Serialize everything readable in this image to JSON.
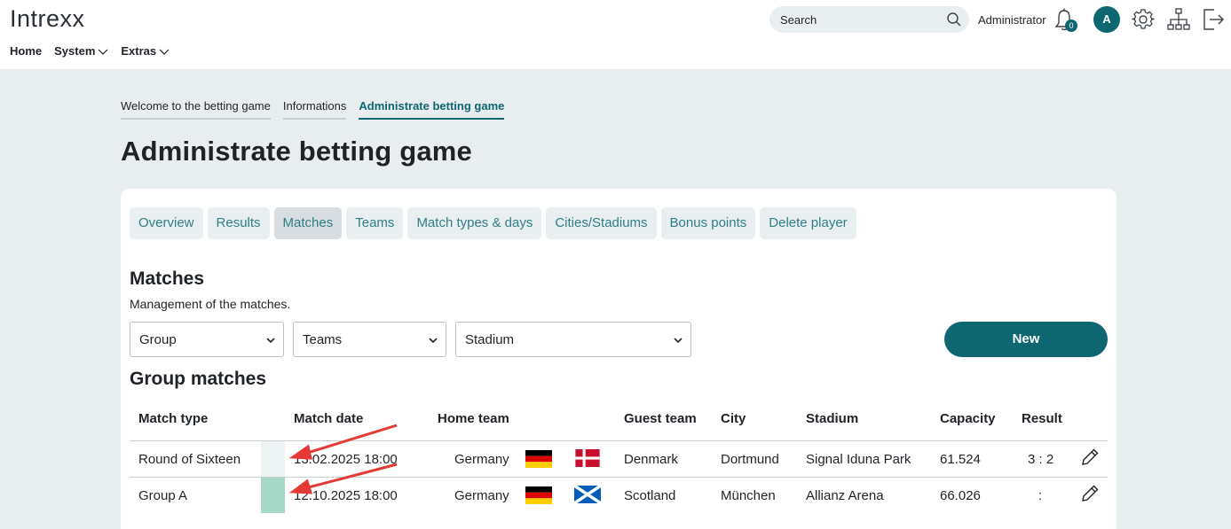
{
  "app": {
    "logo": "Intrexx"
  },
  "nav": [
    {
      "label": "Home",
      "has_menu": false
    },
    {
      "label": "System",
      "has_menu": true
    },
    {
      "label": "Extras",
      "has_menu": true
    }
  ],
  "header": {
    "search_placeholder": "Search",
    "user_name": "Administrator",
    "notification_count": "0",
    "avatar_initial": "A",
    "icons": [
      "search-icon",
      "bell-icon",
      "gear-icon",
      "sitemap-icon",
      "logout-icon"
    ]
  },
  "breadcrumbs": [
    {
      "label": "Welcome to the betting game",
      "active": false
    },
    {
      "label": "Informations",
      "active": false
    },
    {
      "label": "Administrate betting game",
      "active": true
    }
  ],
  "page_title": "Administrate betting game",
  "subtabs": [
    {
      "label": "Overview",
      "active": false
    },
    {
      "label": "Results",
      "active": false
    },
    {
      "label": "Matches",
      "active": true
    },
    {
      "label": "Teams",
      "active": false
    },
    {
      "label": "Match types & days",
      "active": false
    },
    {
      "label": "Cities/Stadiums",
      "active": false
    },
    {
      "label": "Bonus points",
      "active": false
    },
    {
      "label": "Delete player",
      "active": false
    }
  ],
  "section": {
    "title": "Matches",
    "description": "Management of the matches.",
    "filters": {
      "group": "Group",
      "teams": "Teams",
      "stadium": "Stadium"
    },
    "new_button": "New",
    "subtitle": "Group matches"
  },
  "table": {
    "columns": [
      "Match type",
      "Match date",
      "Home team",
      "Guest team",
      "City",
      "Stadium",
      "Capacity",
      "Result"
    ],
    "rows": [
      {
        "match_type": "Round of Sixteen",
        "color": "#eef3f3",
        "match_date": "13.02.2025 18:00",
        "home_team": "Germany",
        "home_flag": "germany-flag-icon",
        "guest_flag": "denmark-flag-icon",
        "guest_team": "Denmark",
        "city": "Dortmund",
        "stadium": "Signal Iduna Park",
        "capacity": "61.524",
        "result": "3 : 2"
      },
      {
        "match_type": "Group A",
        "color": "#a8d8c8",
        "match_date": "12.10.2025 18:00",
        "home_team": "Germany",
        "home_flag": "germany-flag-icon",
        "guest_flag": "scotland-flag-icon",
        "guest_team": "Scotland",
        "city": "München",
        "stadium": "Allianz Arena",
        "capacity": "66.026",
        "result": ":"
      }
    ]
  },
  "colors": {
    "accent": "#0d6670",
    "tab_text": "#2f7e86",
    "annotation_arrow": "#e53935"
  }
}
